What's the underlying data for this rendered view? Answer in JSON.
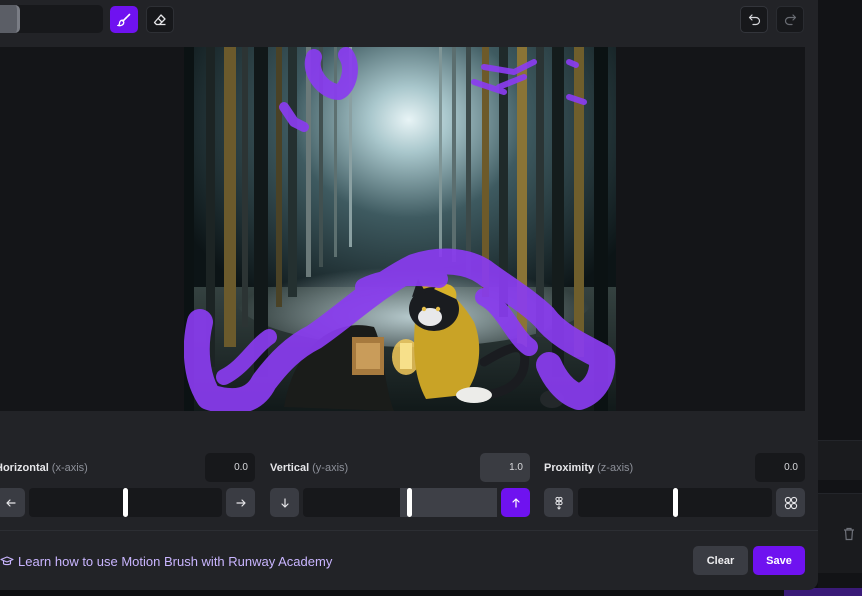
{
  "toolbar": {
    "brush_tool": "paint-brush-icon",
    "eraser_tool": "eraser-icon",
    "undo": "undo-icon",
    "redo": "redo-icon"
  },
  "controls": {
    "horizontal": {
      "label": "Horizontal",
      "axis": "(x-axis)",
      "value": "0.0",
      "level": 0.0,
      "minus_icon": "arrow-left-icon",
      "plus_icon": "arrow-right-icon"
    },
    "vertical": {
      "label": "Vertical",
      "axis": "(y-axis)",
      "value": "1.0",
      "level": 1.0,
      "minus_icon": "arrow-down-icon",
      "plus_icon": "arrow-up-icon"
    },
    "proximity": {
      "label": "Proximity",
      "axis": "(z-axis)",
      "value": "0.0",
      "level": 0.0,
      "minus_icon": "dots-compact-icon",
      "plus_icon": "dots-spread-icon"
    }
  },
  "footer": {
    "academy_link": "Learn how to use Motion Brush with Runway Academy",
    "academy_icon": "graduation-cap-icon",
    "clear_label": "Clear",
    "save_label": "Save"
  },
  "colors": {
    "accent": "#6f12f0",
    "brush_stroke": "#8a3cf0",
    "panel": "#222327",
    "field": "#17181b"
  }
}
